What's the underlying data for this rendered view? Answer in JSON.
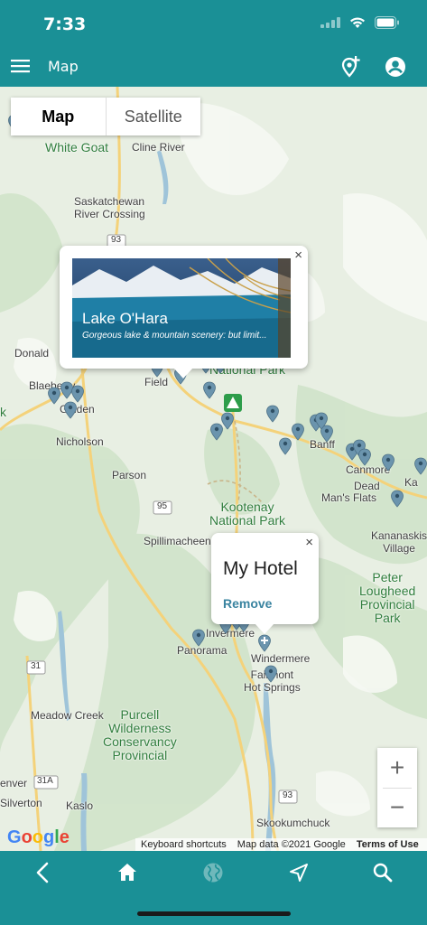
{
  "status_bar": {
    "time": "7:33"
  },
  "app_bar": {
    "title": "Map",
    "icons": [
      "menu-icon",
      "add-location-icon",
      "account-icon"
    ]
  },
  "map_type": {
    "options": [
      "Map",
      "Satellite"
    ],
    "selected": "Map"
  },
  "map_labels": {
    "white_goat": "White Goat",
    "cline_river": "Cline River",
    "saskatchewan_river_crossing": "Saskatchewan\nRiver Crossing",
    "donald": "Donald",
    "blaeberry": "Blaeberry",
    "golden": "Golden",
    "field": "Field",
    "nicholson": "Nicholson",
    "parson": "Parson",
    "spillimacheen": "Spillimacheen",
    "banff": "Banff",
    "canmore": "Canmore",
    "dead": "Dead",
    "mans_flats": "Man's Flats",
    "kananaskis_village": "Kananaskis\nVillage",
    "panorama": "Panorama",
    "invermere": "Invermere",
    "windermere": "Windermere",
    "fairmont_hot_springs": "Fairmont\nHot Springs",
    "meadow_creek": "Meadow Creek",
    "kaslo": "Kaslo",
    "silverton": "Silverton",
    "denver": "enver",
    "skookumchuck": "Skookumchuck",
    "hw93_a": "93",
    "hw95": "95",
    "hw31": "31",
    "hw31a": "31A",
    "hw93_b": "93",
    "ka": "Ka",
    "k": "k"
  },
  "park_labels": {
    "yoho": "National Park",
    "kootenay": "Kootenay\nNational Park",
    "peter_lougheed": "Peter\nLougheed\nProvincial\nPark",
    "purcell": "Purcell\nWilderness\nConservancy\nProvincial"
  },
  "lake_popup": {
    "title": "Lake O'Hara",
    "subtitle": "Gorgeous lake & mountain scenery: but limit...",
    "close": "×"
  },
  "hotel_popup": {
    "title": "My Hotel",
    "action": "Remove",
    "close": "×"
  },
  "zoom": {
    "in": "+",
    "out": "−"
  },
  "google_logo": {
    "G": "G",
    "o1": "o",
    "o2": "o",
    "g": "g",
    "l": "l",
    "e": "e"
  },
  "attribution": {
    "shortcuts": "Keyboard shortcuts",
    "data": "Map data ©2021 Google",
    "terms": "Terms of Use"
  },
  "bottom_nav": {
    "items": [
      "back-icon",
      "home-icon",
      "globe-icon",
      "navigate-icon",
      "search-icon"
    ],
    "active": "globe-icon"
  },
  "colors": {
    "brand": "#1a9096",
    "pin": "#6b94ad",
    "link": "#3a84a0"
  }
}
